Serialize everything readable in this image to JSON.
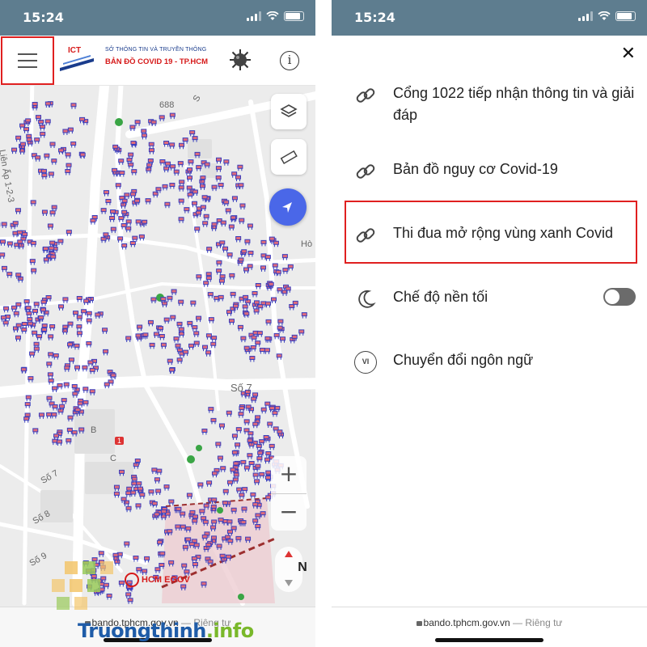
{
  "status_bar": {
    "time_left": "15:24",
    "time_right": "15:24"
  },
  "app_header": {
    "logo_text": "ICT",
    "organization": "SỞ THÔNG TIN VÀ TRUYỀN THÔNG",
    "title": "BẢN ĐỒ  COVID 19 - TP.HCM",
    "info_label": "i"
  },
  "map": {
    "labels": {
      "road_688": "688",
      "lien_ap": "Liên Ấp 1-2-3",
      "so7_street": "Số 7",
      "so7_left": "Số 7",
      "so8": "Số 8",
      "so9": "Số 9",
      "block_b": "B",
      "block_c": "C",
      "route_1": "1",
      "hoa": "Hò",
      "road_s": "S"
    },
    "zoom_in_label": "+",
    "zoom_out_label": "−",
    "compass_label": "N",
    "egov_label": "HCM EGOV"
  },
  "url_bar": {
    "domain": "bando.tphcm.gov.vn",
    "separator": " — ",
    "privacy": "Riêng tư"
  },
  "menu": {
    "close_label": "✕",
    "items": [
      {
        "label": "Cổng 1022 tiếp nhận thông tin và giải đáp",
        "icon": "link-icon"
      },
      {
        "label": "Bản đồ nguy cơ Covid-19",
        "icon": "link-icon"
      },
      {
        "label": "Thi đua mở rộng vùng xanh Covid",
        "icon": "link-icon"
      },
      {
        "label": "Chế độ nền tối",
        "icon": "moon-icon",
        "toggle": false
      },
      {
        "label": "Chuyển đổi ngôn ngữ",
        "icon": "language-icon",
        "badge": "VI"
      }
    ]
  },
  "watermark": {
    "text_main": "Truongthinh",
    "text_accent": ".info"
  },
  "colors": {
    "status_bar": "#5e7d8f",
    "locate_button": "#4a67e8",
    "highlight": "#e02020",
    "title_red": "#d61a1a"
  }
}
